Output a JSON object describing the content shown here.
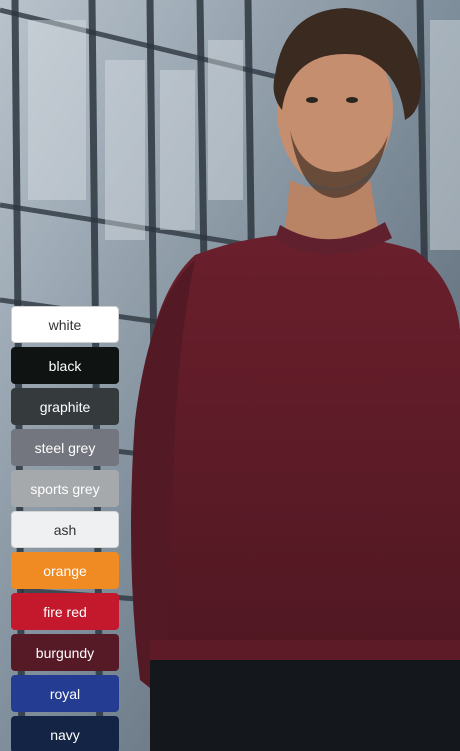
{
  "photo": {
    "scene": "man-in-burgundy-sweatshirt-in-front-of-glass-building",
    "garment_color": "#5a1a24"
  },
  "swatches": [
    {
      "label": "white",
      "color": "#ffffff",
      "text_color": "#333333",
      "border": "#cfcfcf"
    },
    {
      "label": "black",
      "color": "#0f1413",
      "text_color": "#ffffff"
    },
    {
      "label": "graphite",
      "color": "#353b3c",
      "text_color": "#ffffff"
    },
    {
      "label": "steel grey",
      "color": "#74767f",
      "text_color": "#ffffff"
    },
    {
      "label": "sports grey",
      "color": "#a5a9ac",
      "text_color": "#ffffff"
    },
    {
      "label": "ash",
      "color": "#eef0f2",
      "text_color": "#333333",
      "border": "#d5d5d5"
    },
    {
      "label": "orange",
      "color": "#f08a23",
      "text_color": "#ffffff"
    },
    {
      "label": "fire red",
      "color": "#c4192c",
      "text_color": "#ffffff"
    },
    {
      "label": "burgundy",
      "color": "#561a26",
      "text_color": "#ffffff"
    },
    {
      "label": "royal",
      "color": "#243d93",
      "text_color": "#ffffff"
    },
    {
      "label": "navy",
      "color": "#142444",
      "text_color": "#ffffff"
    }
  ]
}
